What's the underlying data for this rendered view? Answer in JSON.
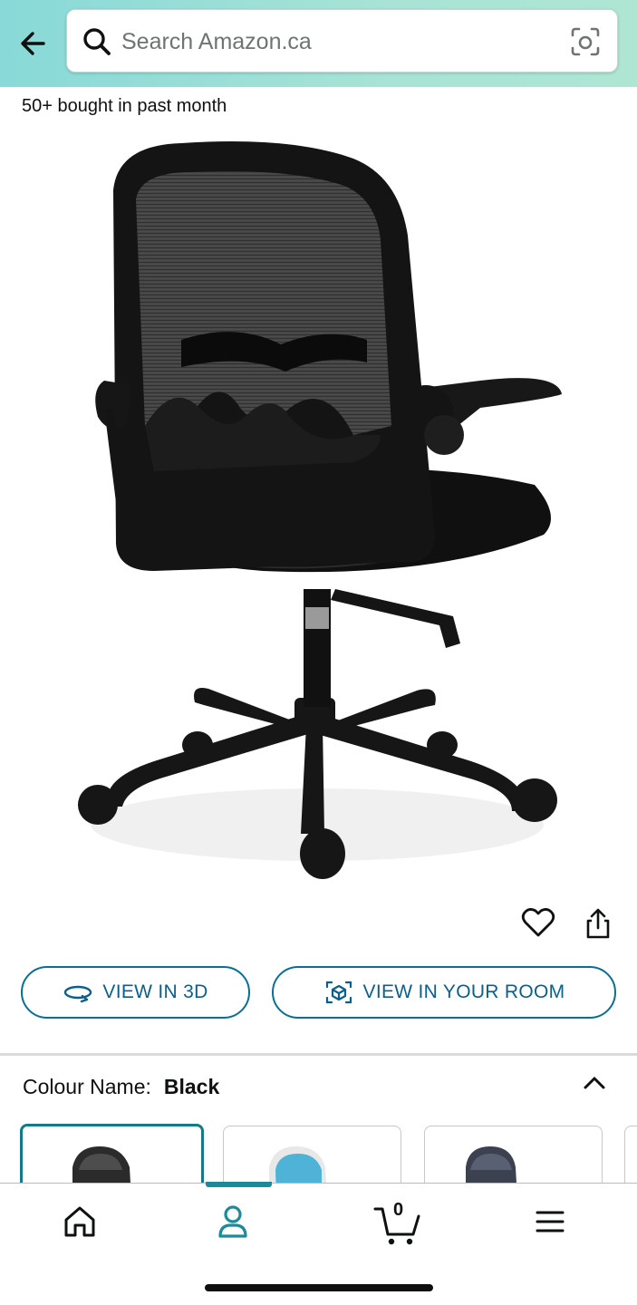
{
  "header": {
    "search_placeholder": "Search Amazon.ca"
  },
  "product": {
    "social_proof": "50+ bought in past month",
    "image_alt": "Black mesh office chair with flip-up armrests"
  },
  "actions": {
    "view_3d_label": "VIEW IN 3D",
    "view_room_label": "VIEW IN YOUR ROOM"
  },
  "variation": {
    "label": "Colour Name:",
    "selected_value": "Black"
  },
  "bottom_nav": {
    "cart_count": "0",
    "active": "you"
  },
  "colors": {
    "accent": "#0b6e93",
    "selected_border": "#127b85",
    "header_gradient_start": "#88d9d8",
    "header_gradient_end": "#aee6d3"
  }
}
